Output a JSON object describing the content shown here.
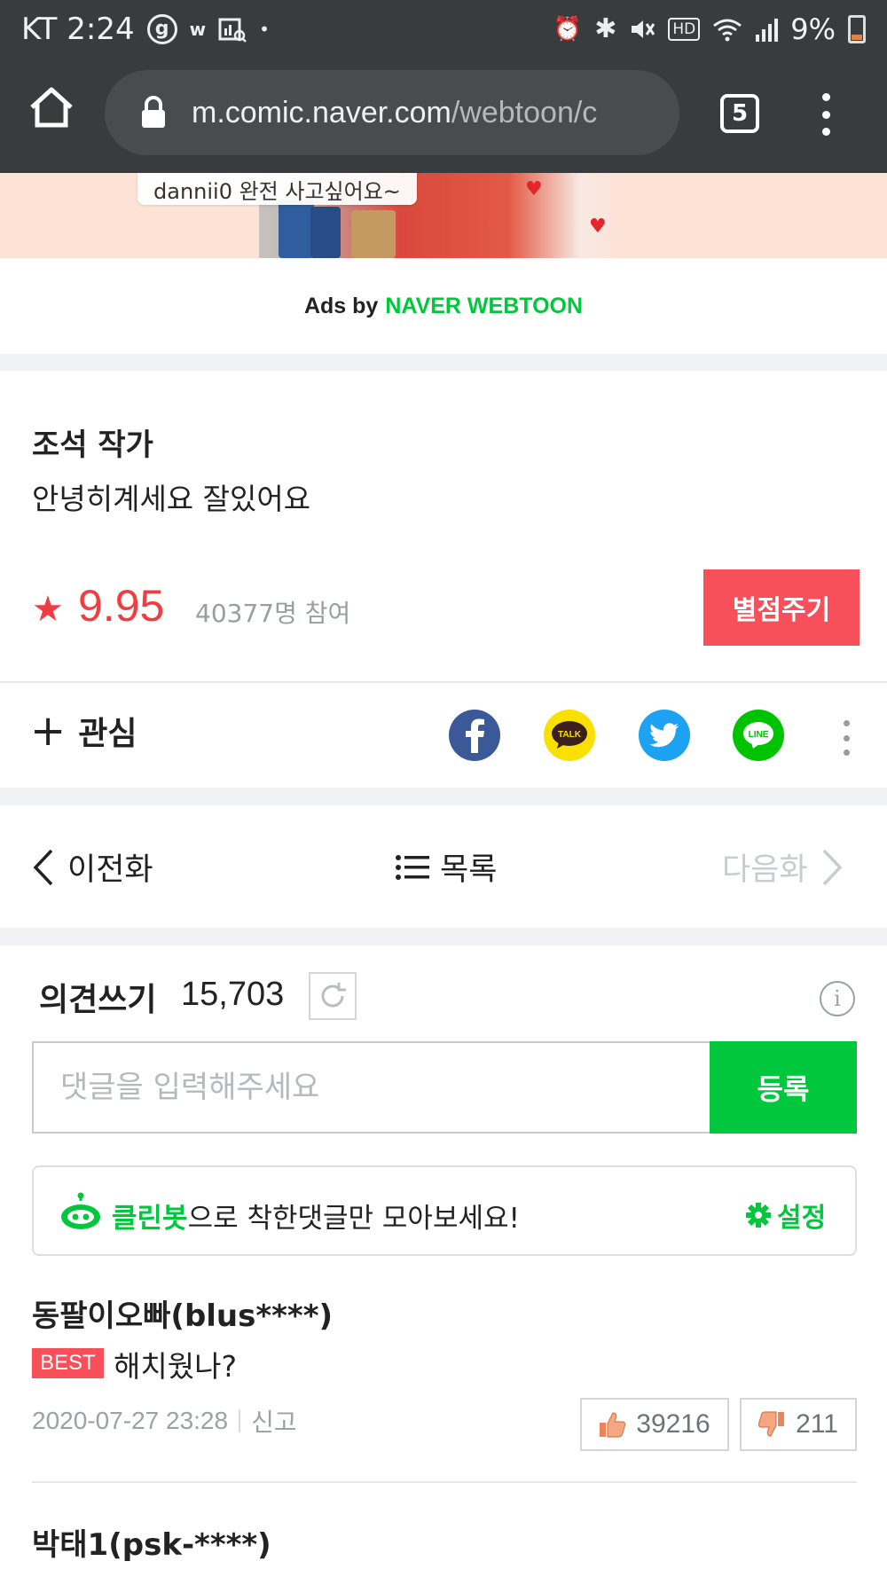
{
  "status_bar": {
    "carrier_time": "KT 2:24",
    "battery": "9%",
    "icons": [
      "g-circle-icon",
      "w-icon",
      "gallery-search-icon",
      "dot-icon",
      "alarm-icon",
      "bluetooth-icon",
      "mute-icon",
      "hd-icon",
      "wifi-icon",
      "signal-icon",
      "battery-icon"
    ]
  },
  "browser": {
    "url_host": "m.comic.naver.com",
    "url_path": "/webtoon/c",
    "tab_count": "5"
  },
  "ad": {
    "caption": "dannii0   완전 사고싶어요~",
    "ads_by": "Ads by",
    "ads_brand": "NAVER WEBTOON",
    "colors": {
      "brand_green": "#00c73c"
    }
  },
  "author": {
    "name": "조석 작가",
    "message": "안녕히계세요 잘있어요"
  },
  "rating": {
    "score": "9.95",
    "participants": "40377명 참여",
    "rate_button": "별점주기",
    "color": "#ef3e42"
  },
  "interest": {
    "label": "관심",
    "share": [
      {
        "name": "facebook",
        "color": "#3b5998",
        "label": "f"
      },
      {
        "name": "kakaotalk",
        "color": "#f9e000",
        "label": "TALK"
      },
      {
        "name": "twitter",
        "color": "#1da1f2",
        "label": ""
      },
      {
        "name": "line",
        "color": "#00c300",
        "label": "LINE"
      }
    ]
  },
  "episode_nav": {
    "prev": "이전화",
    "list": "목록",
    "next": "다음화"
  },
  "comments": {
    "title": "의견쓰기",
    "count": "15,703",
    "input_placeholder": "댓글을 입력해주세요",
    "submit": "등록",
    "cleanbot_name": "클린봇",
    "cleanbot_text": "으로 착한댓글만 모아보세요!",
    "cleanbot_settings": "설정",
    "items": [
      {
        "user": "동팔이오빠(blus****)",
        "badge": "BEST",
        "text": "해치웠나?",
        "date": "2020-07-27 23:28",
        "report": "신고",
        "likes": "39216",
        "dislikes": "211"
      },
      {
        "user": "박태1(psk-****)"
      }
    ]
  }
}
